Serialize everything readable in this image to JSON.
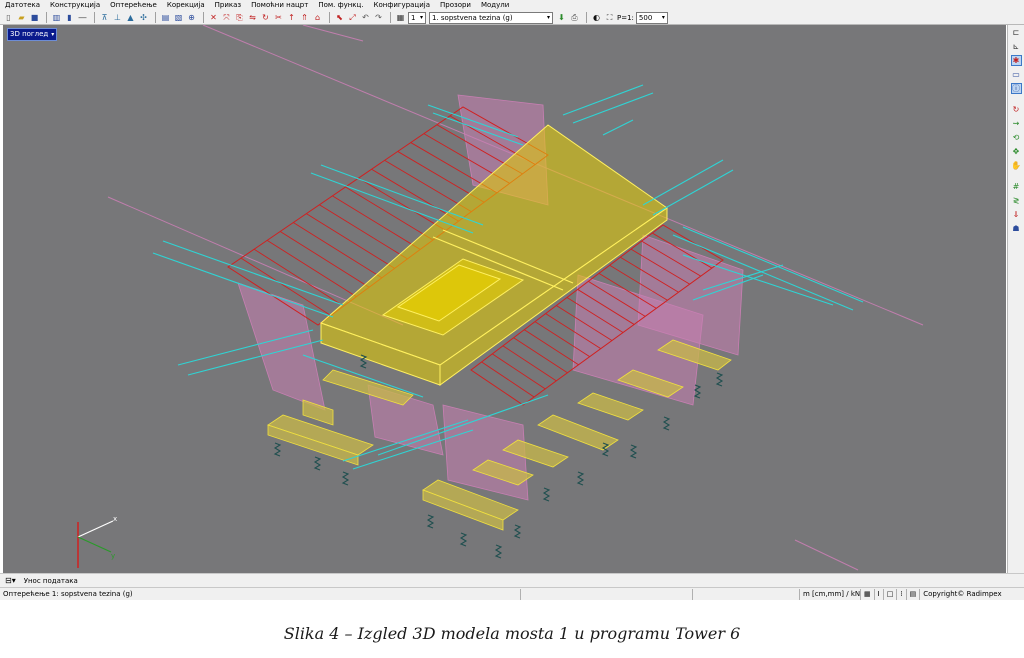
{
  "menu": [
    "Датотека",
    "Конструкција",
    "Оптерећење",
    "Корекција",
    "Приказ",
    "Помоћни нацрт",
    "Пом. функц.",
    "Конфигурација",
    "Прозори",
    "Модули"
  ],
  "toolbar": {
    "load_case_number": "1",
    "load_case_name": "1. sopstvena tezina (g)",
    "scale_label": "P=1:",
    "scale_value": "500"
  },
  "viewport": {
    "view_label": "3D поглед",
    "background": "#777779",
    "colors": {
      "deck": "#e8d000",
      "walls": "#c87fb3",
      "stairs": "#d02020",
      "axis_lines": "#2fd4d4",
      "supports": "#1f4f4f"
    },
    "axis_labels": {
      "x": "x",
      "y": "y"
    }
  },
  "input_bar": {
    "label": "Унос података"
  },
  "status_bar": {
    "load_case": "Оптерећење 1: sopstvena tezina (g)",
    "units": "m [cm,mm] / kN",
    "copyright": "Copyright© Radimpex"
  },
  "caption": "Slika 4 – Izgled 3D modela mosta 1 u programu Tower 6"
}
